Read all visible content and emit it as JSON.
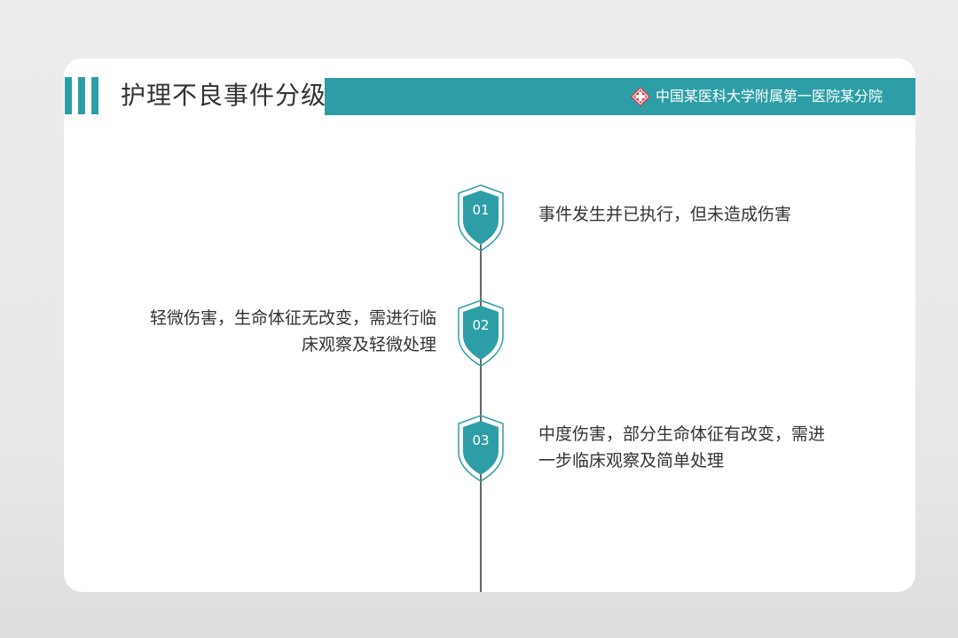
{
  "header": {
    "title": "护理不良事件分级",
    "hospital": "中国某医科大学附属第一医院某分院"
  },
  "colors": {
    "accent": "#2e9ea6",
    "shield_fill": "#2e9ea6",
    "shield_outline": "#2e9ea6",
    "logo_red": "#d9363e",
    "text": "#333333"
  },
  "timeline": [
    {
      "num": "01",
      "text": "事件发生并已执行，但未造成伤害",
      "side": "right"
    },
    {
      "num": "02",
      "text_lines": [
        "轻微伤害，生命体征无改变，需进行临",
        "床观察及轻微处理"
      ],
      "side": "left"
    },
    {
      "num": "03",
      "text_lines": [
        "中度伤害，部分生命体征有改变，需进",
        "一步临床观察及简单处理"
      ],
      "side": "right"
    }
  ]
}
